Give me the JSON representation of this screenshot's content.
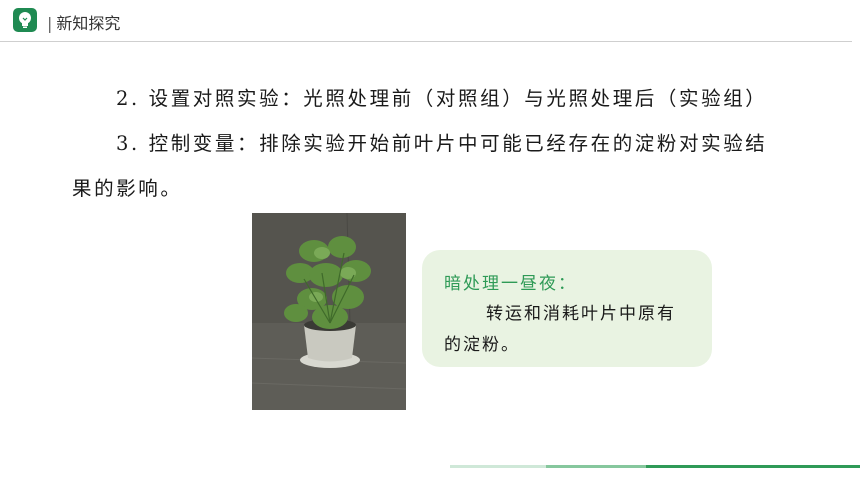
{
  "header": {
    "title": "新知探究",
    "icon": "lightbulb-icon",
    "accent_color": "#1f8a52"
  },
  "content": {
    "para1": "2. 设置对照实验：光照处理前（对照组）与光照处理后（实验组）",
    "para2": "3. 控制变量：排除实验开始前叶片中可能已经存在的淀粉对实验结",
    "para3": "果的影响。"
  },
  "bubble": {
    "title": "暗处理一昼夜：",
    "line1": "转运和消耗叶片中原有",
    "line2": "的淀粉。",
    "background": "#e9f3e2",
    "title_color": "#2e9a56"
  },
  "footer": {
    "colors": [
      "#cfe8d8",
      "#86c79d",
      "#2f9a57"
    ]
  }
}
